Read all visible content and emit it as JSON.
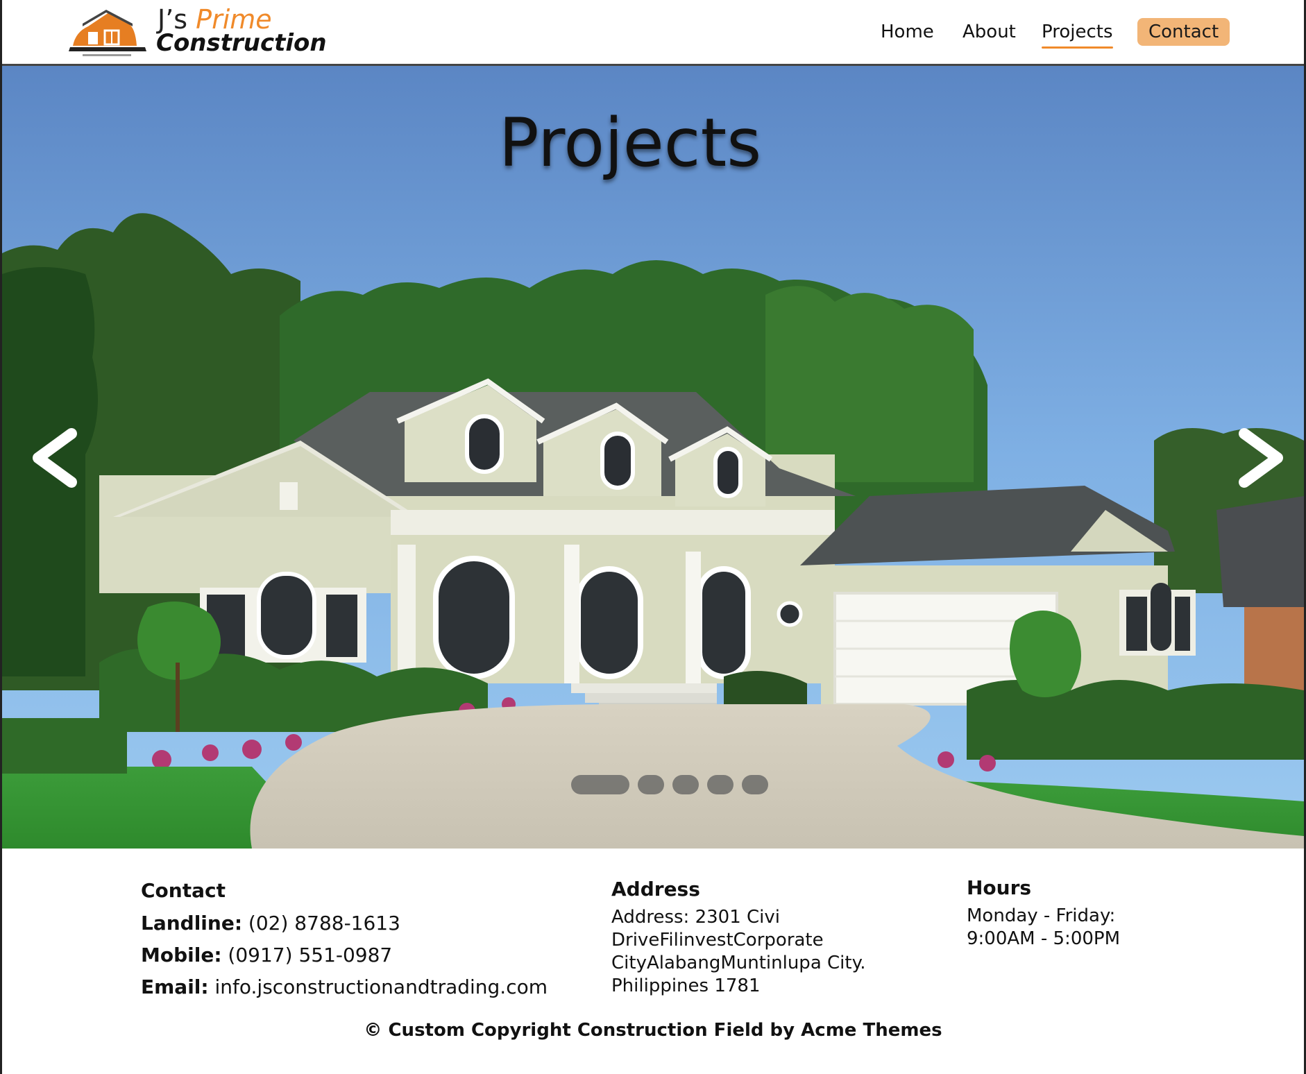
{
  "header": {
    "brand_line1_part1": "J’s ",
    "brand_line1_part2": "Prime",
    "brand_line2": "Construction",
    "brand_color": "#f08a2a",
    "nav": {
      "home": "Home",
      "about": "About",
      "projects": "Projects",
      "contact": "Contact"
    },
    "active_nav": "Projects",
    "contact_button_color": "#f2b577"
  },
  "hero": {
    "title": "Projects",
    "prev_icon": "chevron-left-icon",
    "next_icon": "chevron-right-icon",
    "slide_count": 5,
    "active_slide": 1
  },
  "footer": {
    "contact": {
      "title": "Contact",
      "landline_label": "Landline:",
      "landline_value": " (02) 8788-1613",
      "mobile_label": "Mobile:",
      "mobile_value": " (0917) 551-0987",
      "email_label": "Email:",
      "email_value": " info.jsconstructionandtrading.com"
    },
    "address": {
      "title": "Address",
      "lines": [
        "Address: 2301 Civi",
        "DriveFilinvestCorporate",
        "CityAlabangMuntinlupa City.",
        "Philippines 1781"
      ]
    },
    "hours": {
      "title": "Hours",
      "lines": [
        "Monday - Friday:",
        "9:00AM - 5:00PM"
      ]
    },
    "copyright": "© Custom Copyright Construction Field by Acme Themes"
  }
}
